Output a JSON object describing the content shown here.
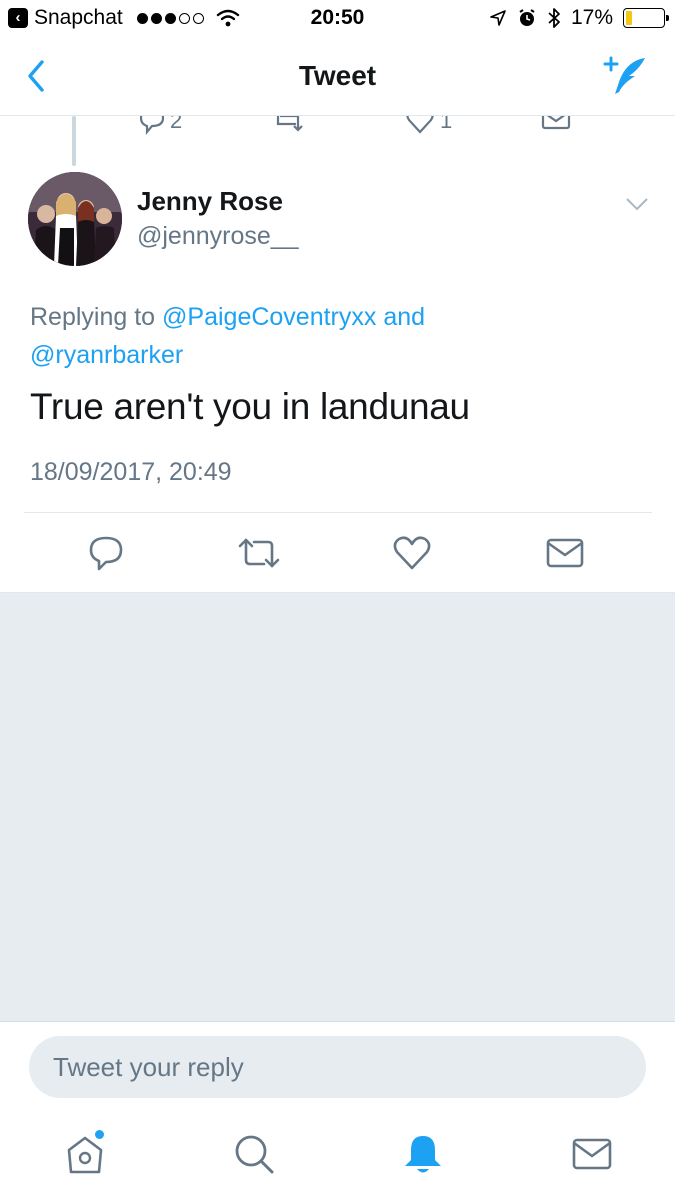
{
  "status_bar": {
    "back_app": "Snapchat",
    "time": "20:50",
    "battery": "17%",
    "battery_level": 0.17
  },
  "nav": {
    "title": "Tweet"
  },
  "prev_tweet": {
    "reply_count": "2",
    "like_count": "1"
  },
  "tweet": {
    "name": "Jenny Rose",
    "handle": "@jennyrose__",
    "replying_prefix": "Replying to",
    "mention1": "@PaigeCoventryxx",
    "and_word": "and",
    "mention2": "@ryanrbarker",
    "text": "True aren't you in landunau",
    "timestamp": "18/09/2017, 20:49"
  },
  "reply_box": {
    "placeholder": "Tweet your reply"
  },
  "colors": {
    "accent": "#1da1f2",
    "secondary_text": "#657786",
    "background_gray": "#e6ecf0",
    "battery": "#f5c518"
  }
}
